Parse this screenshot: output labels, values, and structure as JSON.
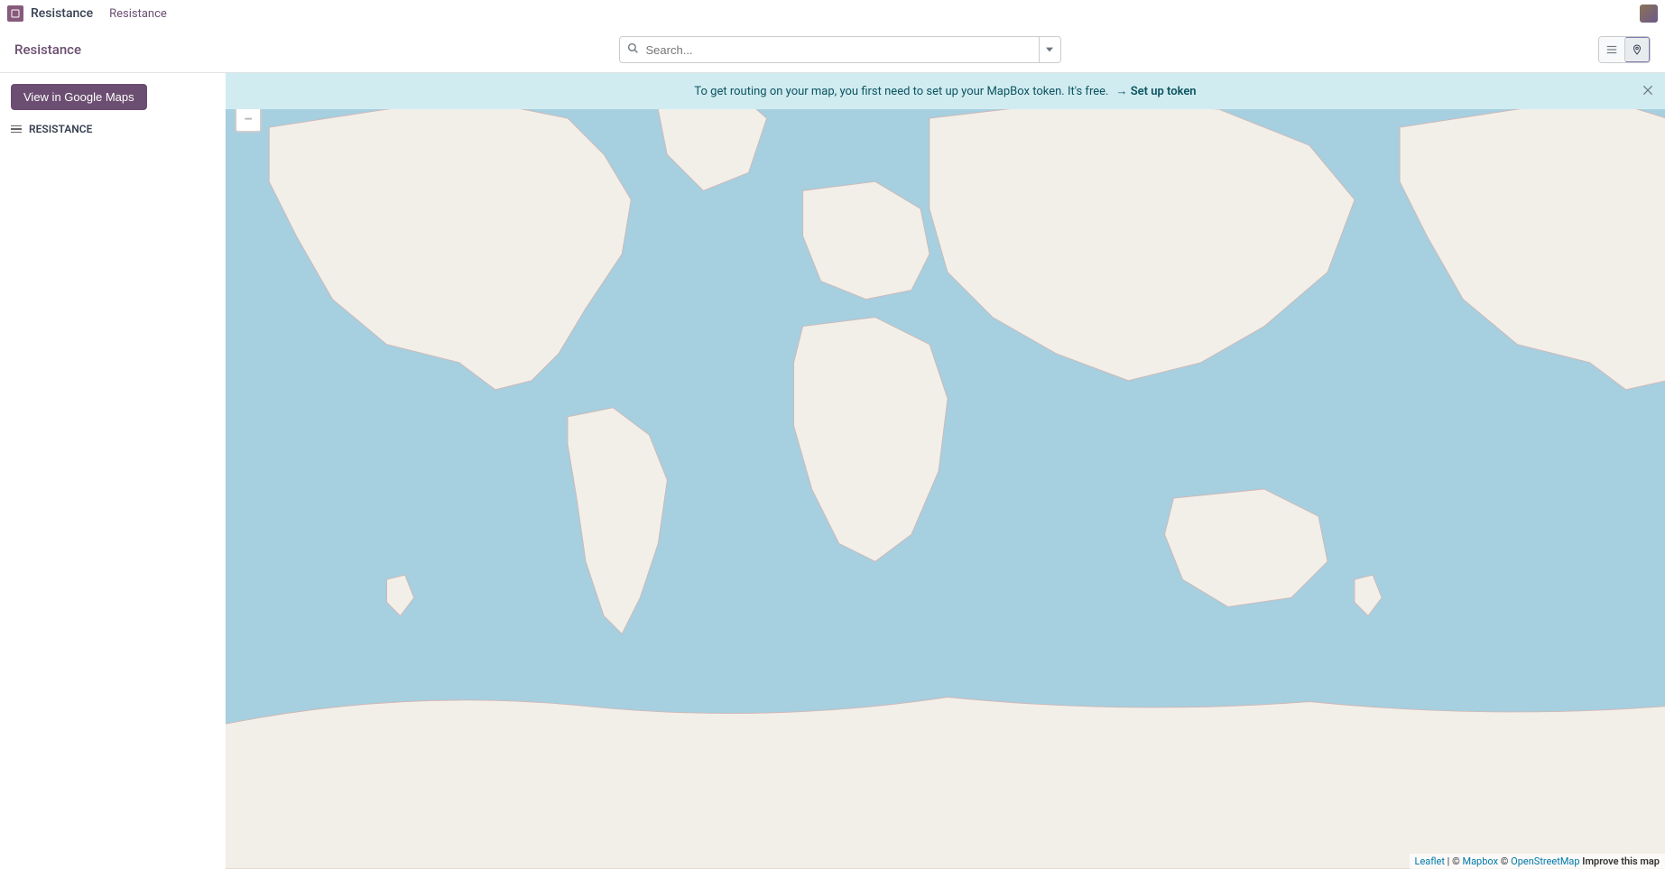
{
  "nav": {
    "app_name": "Resistance",
    "menu_item": "Resistance"
  },
  "control": {
    "breadcrumb": "Resistance",
    "search_placeholder": "Search..."
  },
  "sidebar": {
    "gmaps_button": "View in Google Maps",
    "item_label": "RESISTANCE"
  },
  "alert": {
    "message": "To get routing on your map, you first need to set up your MapBox token. It's free.",
    "arrow": "→",
    "link_text": "Set up token"
  },
  "zoom": {
    "in": "+",
    "out": "−"
  },
  "attribution": {
    "leaflet": "Leaflet",
    "sep1": " | © ",
    "mapbox": "Mapbox",
    "sep2": " © ",
    "osm": "OpenStreetMap",
    "improve": " Improve this map"
  }
}
